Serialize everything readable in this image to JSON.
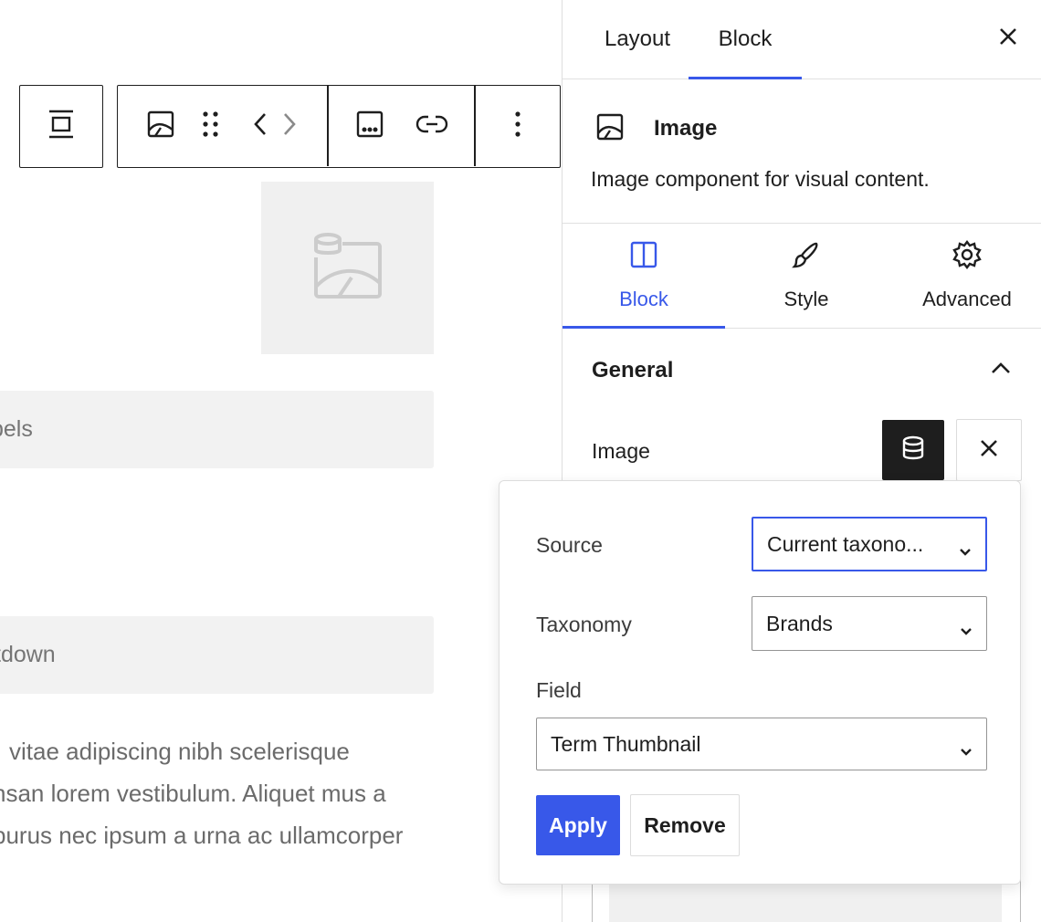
{
  "canvas": {
    "toolbar": {
      "align_icon": "align-center-icon",
      "block_type_icon": "image-icon",
      "drag_icon": "drag-handle-icon",
      "move_icon": "chevron-left-right-icon",
      "caption_icon": "caption-icon",
      "link_icon": "link-icon",
      "options_icon": "more-vertical-icon"
    },
    "placeholder_icon": "image-database-icon",
    "field1_text": "bels",
    "field2_text": "tdown",
    "paragraph_lines": [
      "vitae adipiscing nibh scelerisque",
      "nsan lorem vestibulum. Aliquet mus a",
      "purus nec ipsum a urna ac ullamcorper"
    ]
  },
  "sidebar": {
    "tabs": [
      "Layout",
      "Block"
    ],
    "active_tab": "Block",
    "block": {
      "title": "Image",
      "description": "Image component for visual content."
    },
    "inner_tabs": [
      "Block",
      "Style",
      "Advanced"
    ],
    "active_inner_tab": "Block",
    "panel": {
      "title": "General",
      "image_label": "Image"
    }
  },
  "popover": {
    "source_label": "Source",
    "source_value": "Current taxono...",
    "taxonomy_label": "Taxonomy",
    "taxonomy_value": "Brands",
    "field_label": "Field",
    "field_value": "Term Thumbnail",
    "apply_label": "Apply",
    "remove_label": "Remove"
  },
  "colors": {
    "accent": "#3858e9",
    "dark": "#1e1e1e",
    "placeholder_bg": "#f0f0f0"
  }
}
